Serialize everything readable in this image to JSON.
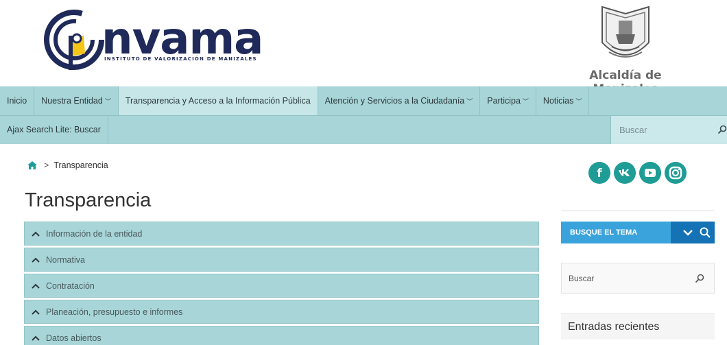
{
  "header": {
    "logo_word": "nvama",
    "logo_subtitle": "INSTITUTO DE VALORIZACIÓN DE MANIZALES",
    "alcaldia": "Alcaldía de Manizales"
  },
  "nav": {
    "items": [
      {
        "label": "Inicio",
        "has_dropdown": false
      },
      {
        "label": "Nuestra Entidad",
        "has_dropdown": true
      },
      {
        "label": "Transparencia y Acceso a la Información Pública",
        "has_dropdown": false
      },
      {
        "label": "Atención y Servicios a la Ciudadanía",
        "has_dropdown": true
      },
      {
        "label": "Participa",
        "has_dropdown": true
      },
      {
        "label": "Noticias",
        "has_dropdown": true
      }
    ],
    "ajax_search": "Ajax Search Lite: Buscar",
    "search_placeholder": "Buscar"
  },
  "breadcrumb": {
    "current": "Transparencia"
  },
  "page_title": "Transparencia",
  "accordion": [
    "Información de la entidad",
    "Normativa",
    "Contratación",
    "Planeación, presupuesto e informes",
    "Datos abiertos"
  ],
  "social": [
    "f",
    "vk",
    "yt",
    "ig"
  ],
  "sidebar": {
    "busque_label": "BUSQUE EL TEMA",
    "search_placeholder": "Buscar",
    "recent_title": "Entradas recientes"
  },
  "colors": {
    "nav_bg": "#a8d5d7",
    "accent_blue": "#3aa3dc",
    "accent_dark_blue": "#1573b5",
    "social_teal": "#1e9c95",
    "logo_navy": "#1f2a5a",
    "logo_yellow": "#f5c518"
  }
}
